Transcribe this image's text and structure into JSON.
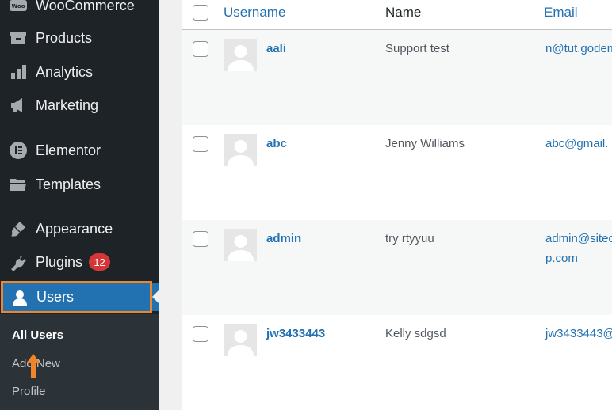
{
  "sidebar": {
    "items": [
      {
        "label": "WooCommerce",
        "icon": "woo-icon"
      },
      {
        "label": "Products",
        "icon": "products-icon"
      },
      {
        "label": "Analytics",
        "icon": "analytics-icon"
      },
      {
        "label": "Marketing",
        "icon": "megaphone-icon"
      },
      {
        "label": "Elementor",
        "icon": "elementor-icon"
      },
      {
        "label": "Templates",
        "icon": "folder-icon"
      },
      {
        "label": "Appearance",
        "icon": "brush-icon"
      },
      {
        "label": "Plugins",
        "icon": "plugin-icon",
        "badge": "12"
      },
      {
        "label": "Users",
        "icon": "user-icon"
      }
    ],
    "submenu": [
      {
        "label": "All Users"
      },
      {
        "label": "Add New"
      },
      {
        "label": "Profile"
      }
    ]
  },
  "table": {
    "columns": {
      "username": "Username",
      "name": "Name",
      "email": "Email"
    },
    "rows": [
      {
        "username": "aali",
        "name": "Support test",
        "email": "n@tut.godem"
      },
      {
        "username": "abc",
        "name": "Jenny Williams",
        "email": "abc@gmail."
      },
      {
        "username": "admin",
        "name": "try rtyyuu",
        "email": "admin@siteop.com"
      },
      {
        "username": "jw3433443",
        "name": "Kelly sdgsd",
        "email": "jw3433443@"
      }
    ]
  },
  "colors": {
    "sidebar_bg": "#1d2327",
    "active_bg": "#2271b1",
    "highlight": "#f0852a",
    "badge": "#d63638",
    "link": "#2271b1"
  }
}
